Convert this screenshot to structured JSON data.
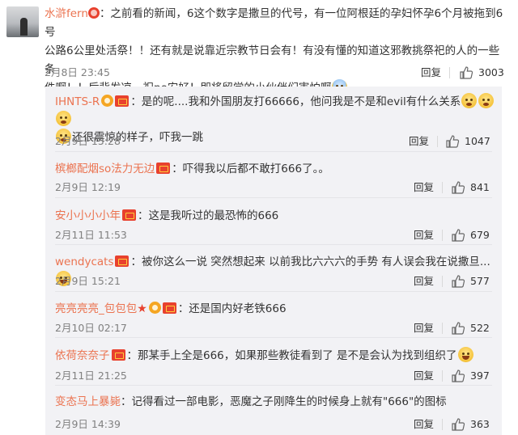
{
  "main": {
    "username": "水滸fern",
    "text1": "：之前看的新闻，6这个数字是撒旦的代号，有一位阿根廷的孕妇怀孕6个月被拖到6号",
    "text2": "公路6公里处活祭！！还有就是说靠近宗教节日会有！有没有懂的知道这邪教挑祭祀的人的一些条",
    "text3": "件啊！！后背发凉，祝po安好！即将留学的小伙伴们害怕啊",
    "date": "2月8日 23:45",
    "reply_label": "回复",
    "likes": "3003"
  },
  "replies": [
    {
      "username": "IHNTS-R",
      "text": "：是的呢....我和外国朋友打66666，他问我是不是和evil有什么关系",
      "text_cont": "还很震惊的样子，吓我一跳",
      "date": "2月9日 15:28",
      "reply_label": "回复",
      "likes": "1047"
    },
    {
      "username": "槟榔配烟so法力无边",
      "text": "：吓得我以后都不敢打666了。。",
      "date": "2月9日 12:19",
      "reply_label": "回复",
      "likes": "841"
    },
    {
      "username": "安小小小小年",
      "text": "：这是我听过的最恐怖的666",
      "date": "2月11日 11:53",
      "reply_label": "回复",
      "likes": "679"
    },
    {
      "username": "wendycats",
      "text": "：被你这么一说 突然想起来 以前我比六六六的手势 有人误会我在说撒旦...",
      "date": "2月9日 15:21",
      "reply_label": "回复",
      "likes": "577"
    },
    {
      "username": "亮亮亮亮_包包包",
      "text": "：还是国内好老铁666",
      "date": "2月10日 02:17",
      "reply_label": "回复",
      "likes": "522"
    },
    {
      "username": "依荷奈奈子",
      "text": "：那某手上全是666，如果那些教徒看到了 是不是会认为找到组织了",
      "date": "2月11日 21:25",
      "reply_label": "回复",
      "likes": "397"
    },
    {
      "username": "变态马上暴毙",
      "text": "：记得看过一部电影，恶魔之子刚降生的时候身上就有\"666\"的图标",
      "date": "2月9日 14:39",
      "reply_label": "回复",
      "likes": "363"
    }
  ],
  "icons": {
    "like": "thumbs-up-icon",
    "vip": "red-envelope-icon",
    "emoji": "emoji-icon"
  },
  "colors": {
    "username": "#eb7350",
    "reply_bg": "#f2f2f5",
    "vip_red": "#e8412e"
  }
}
